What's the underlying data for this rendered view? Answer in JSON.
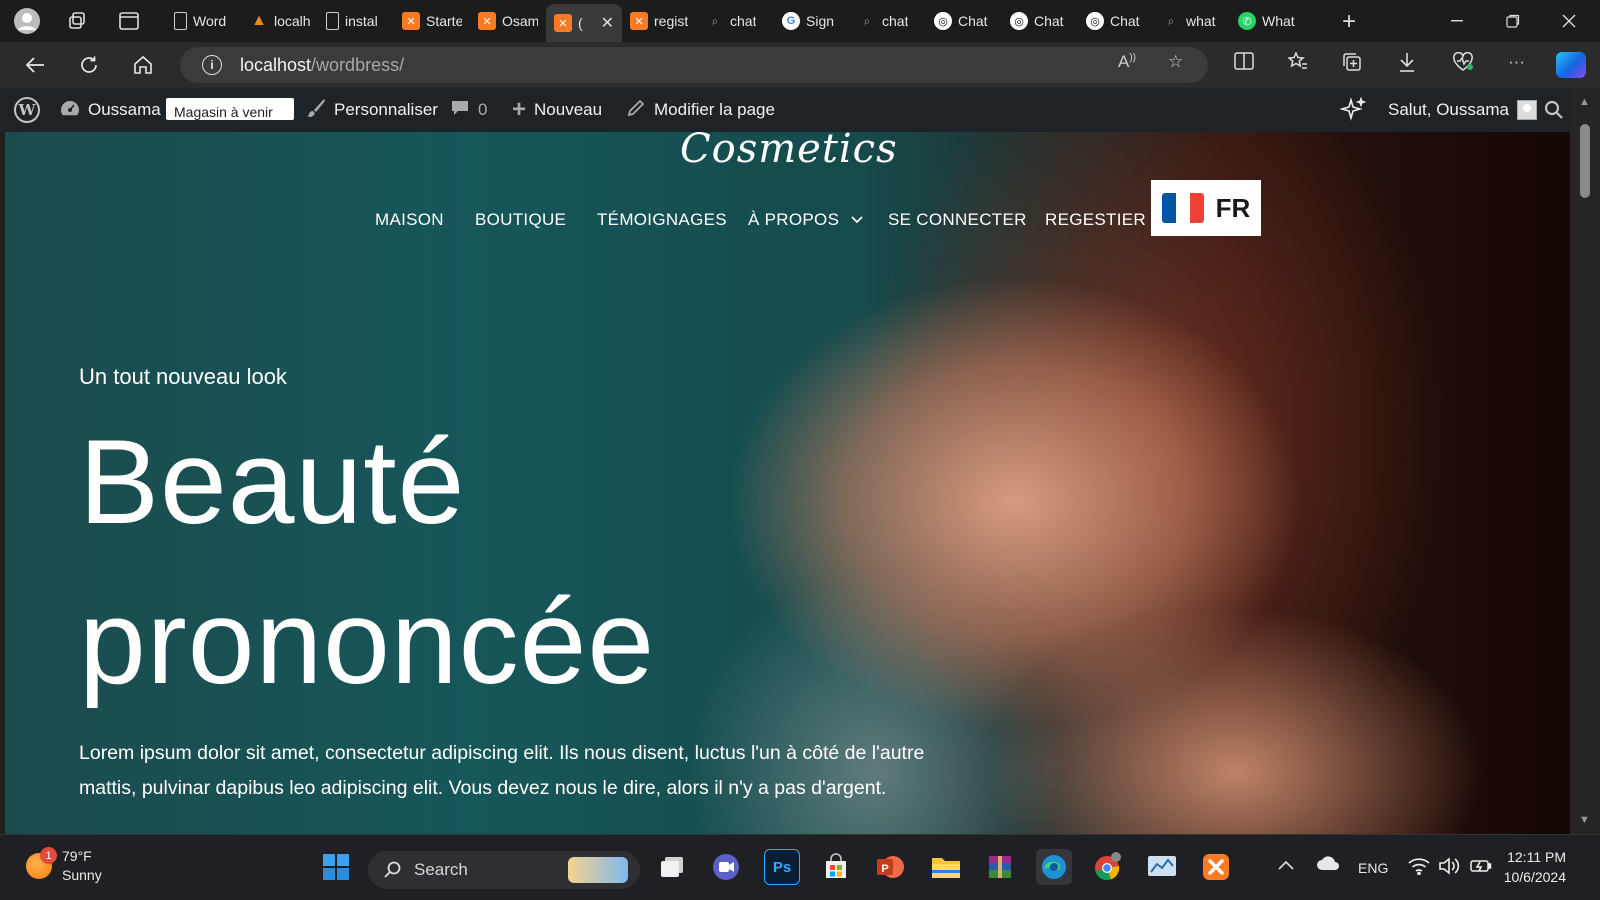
{
  "browser": {
    "tabs": [
      {
        "label": "Word",
        "icon": "doc"
      },
      {
        "label": "localh",
        "icon": "vlc"
      },
      {
        "label": "instal",
        "icon": "doc"
      },
      {
        "label": "Starte",
        "icon": "xampp"
      },
      {
        "label": "Osam",
        "icon": "xampp"
      },
      {
        "label": "(",
        "icon": "xampp",
        "active": true
      },
      {
        "label": "regist",
        "icon": "xampp"
      },
      {
        "label": "chat",
        "icon": "search"
      },
      {
        "label": "Sign",
        "icon": "google"
      },
      {
        "label": "chat",
        "icon": "search"
      },
      {
        "label": "Chat",
        "icon": "gpt"
      },
      {
        "label": "Chat",
        "icon": "gpt"
      },
      {
        "label": "Chat",
        "icon": "gpt"
      },
      {
        "label": "what",
        "icon": "search"
      },
      {
        "label": "What",
        "icon": "whatsapp"
      }
    ],
    "url_host": "localhost",
    "url_path": "/wordbress/",
    "accent": "#fb7a24"
  },
  "adminbar": {
    "site_name": "Oussama",
    "store_badge": "Magasin à venir",
    "customize": "Personnaliser",
    "comments_count": "0",
    "new": "Nouveau",
    "edit_page": "Modifier la page",
    "greeting": "Salut, Oussama"
  },
  "site": {
    "logo": "Cosmetics",
    "menu": [
      "MAISON",
      "BOUTIQUE",
      "TÉMOIGNAGES",
      "À PROPOS",
      "SE CONNECTER",
      "REGESTIER"
    ],
    "language": "FR",
    "flag_colors": [
      "#0055a4",
      "#ffffff",
      "#ef4135"
    ]
  },
  "hero": {
    "subheading": "Un tout nouveau look",
    "headline_line1": "Beauté",
    "headline_line2": "prononcée",
    "paragraph": "Lorem ipsum dolor sit amet, consectetur adipiscing elit. Ils nous disent, luctus l'un à côté de l'autre mattis, pulvinar dapibus leo adipiscing elit. Vous devez nous le dire, alors il n'y a pas d'argent."
  },
  "taskbar": {
    "temperature": "79°F",
    "condition": "Sunny",
    "weather_badge": "1",
    "search_placeholder": "Search",
    "language": "ENG",
    "time": "12:11 PM",
    "date": "10/6/2024"
  }
}
